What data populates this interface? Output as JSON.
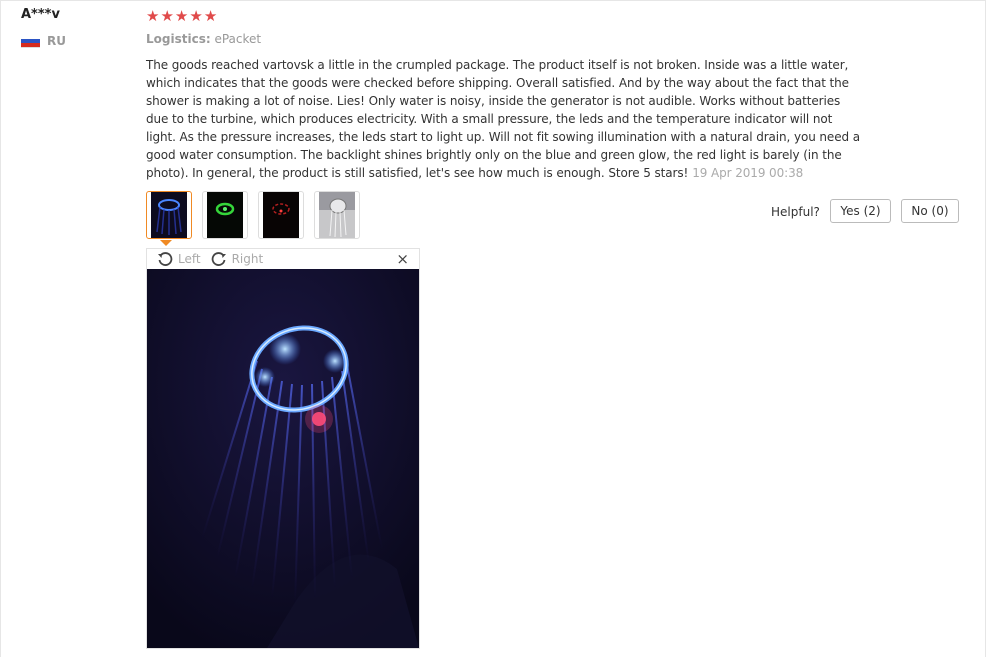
{
  "user": {
    "name": "A***v",
    "country": "RU"
  },
  "rating": {
    "stars": 5,
    "star_char": "★",
    "color": "#e04a4a"
  },
  "logistics": {
    "label": "Logistics:",
    "value": "ePacket"
  },
  "review": {
    "text": "The goods reached vartovsk a little in the crumpled package. The product itself is not broken. Inside was a little water, which indicates that the goods were checked before shipping. Overall satisfied. And by the way about the fact that the shower is making a lot of noise. Lies! Only water is noisy, inside the generator is not audible. Works without batteries due to the turbine, which produces electricity. With a small pressure, the leds and the temperature indicator will not light. As the pressure increases, the leds start to light up. Will not fit sowing illumination with a natural drain, you need a good water consumption. The backlight shines brightly only on the blue and green glow, the red light is barely (in the photo). In general, the product is still satisfied, let's see how much is enough. Store 5 stars!",
    "date": "19 Apr 2019 00:38"
  },
  "helpful": {
    "label": "Helpful?",
    "yes_label": "Yes (2)",
    "no_label": "No (0)"
  },
  "viewer": {
    "rotate_left_label": "Left",
    "rotate_right_label": "Right",
    "close_label": "×"
  },
  "thumbnails": [
    {
      "name": "blue-glow",
      "color": "#2e6bff"
    },
    {
      "name": "green-glow",
      "color": "#35d53a"
    },
    {
      "name": "red-glow",
      "color": "#d82a2a"
    },
    {
      "name": "shower-head",
      "color": "#b9b9b9"
    }
  ]
}
